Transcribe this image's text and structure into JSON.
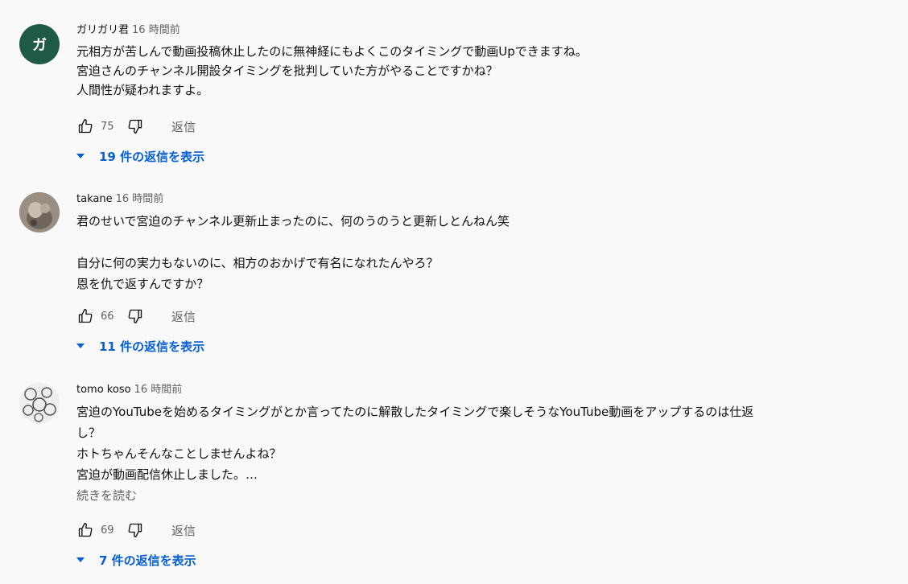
{
  "comments": [
    {
      "avatar_letter": "ガ",
      "avatar_color": "#1e5a46",
      "author": "ガリガリ君",
      "time": "16 時間前",
      "lines": [
        "元相方が苦しんで動画投稿休止したのに無神経にもよくこのタイミングで動画Upできますね。",
        "宮迫さんのチャンネル開設タイミングを批判していた方がやることですかね？",
        "人間性が疑われますよ。"
      ],
      "likes": "75",
      "reply_label": "返信",
      "replies_label": "19 件の返信を表示"
    },
    {
      "author": "takane",
      "time": "16 時間前",
      "lines": [
        "君のせいで宮迫のチャンネル更新止まったのに、何のうのうと更新しとんねん笑",
        "",
        "自分に何の実力もないのに、相方のおかげで有名になれたんやろ？",
        "恩を仇で返すんですか？"
      ],
      "likes": "66",
      "reply_label": "返信",
      "replies_label": "11 件の返信を表示"
    },
    {
      "author": "tomo koso",
      "time": "16 時間前",
      "lines": [
        "宮迫のYouTubeを始めるタイミングがとか言ってたのに解散したタイミングで楽しそうなYouTube動画をアップするのは仕返",
        "し？",
        "ホトちゃんそんなことしませんよね？",
        "宮迫が動画配信休止しました。…"
      ],
      "read_more": "続きを読む",
      "likes": "69",
      "reply_label": "返信",
      "replies_label": "7 件の返信を表示"
    }
  ],
  "icons": {
    "like": "thumbs-up-icon",
    "dislike": "thumbs-down-icon",
    "expand": "caret-down-icon"
  }
}
